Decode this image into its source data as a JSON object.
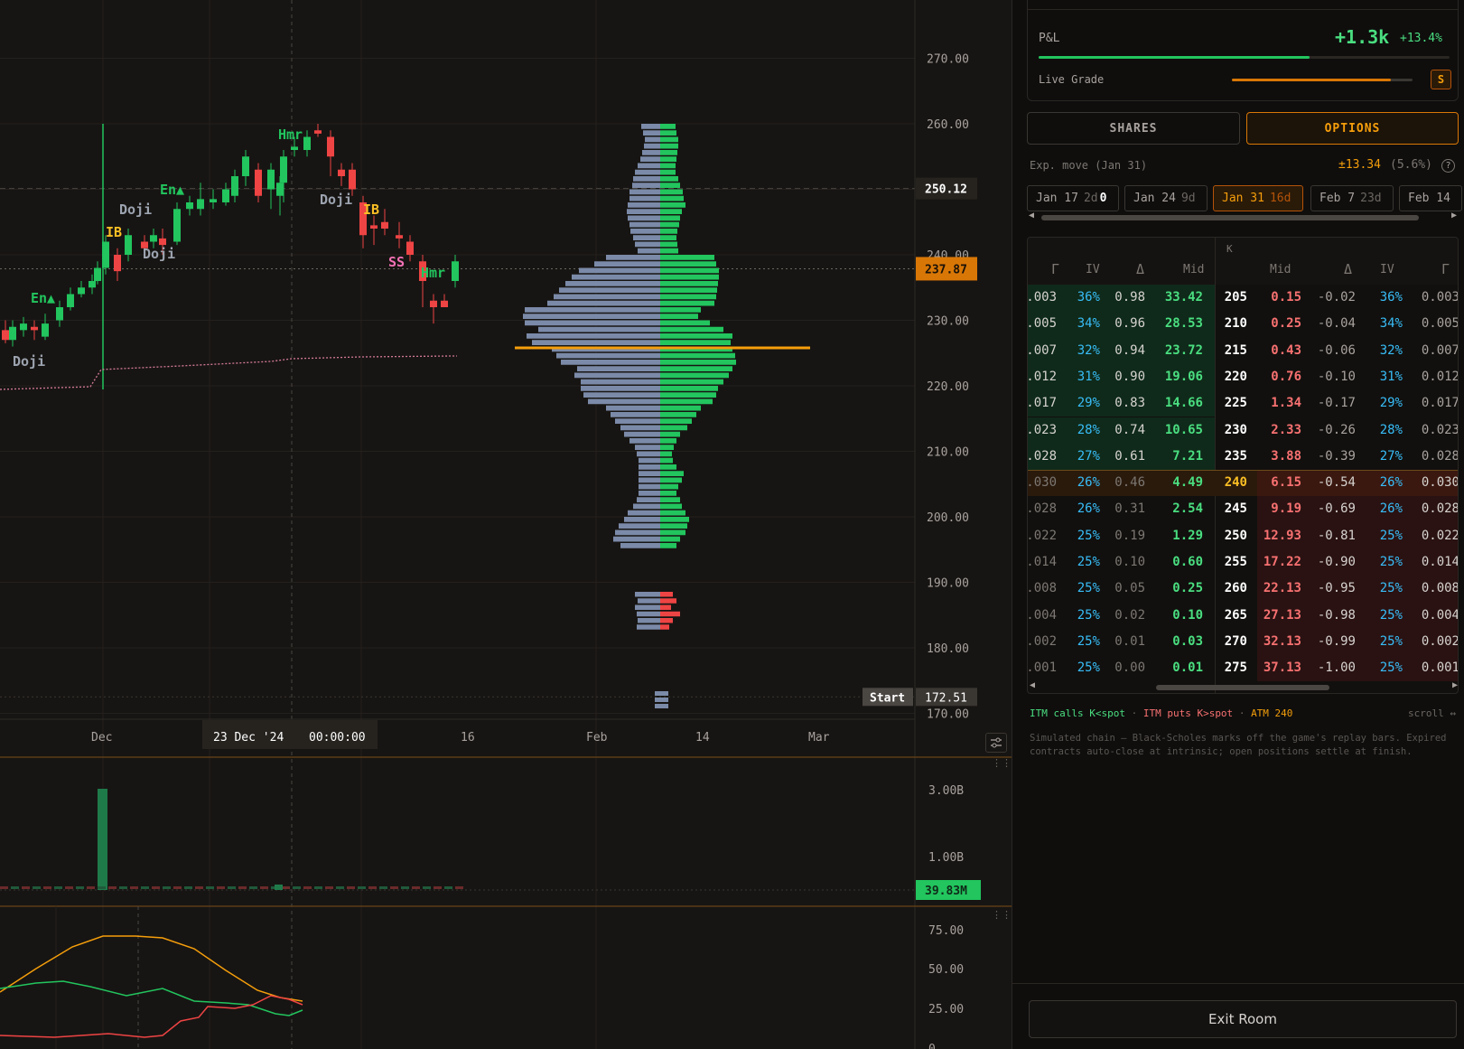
{
  "chart": {
    "price_ticks": [
      "270.00",
      "260.00",
      "250.00",
      "240.00",
      "230.00",
      "220.00",
      "210.00",
      "200.00",
      "190.00",
      "180.00",
      "170.00"
    ],
    "cursor_price": "250.12",
    "last_price": "237.87",
    "start_label": "Start",
    "start_price": "172.51",
    "time_labels": [
      "Dec",
      "16",
      "Feb",
      "14",
      "Mar"
    ],
    "crosshair_date": "23 Dec '24",
    "crosshair_time": "00:00:00",
    "patterns": [
      "Doji",
      "En▲",
      "IB",
      "Doji",
      "Doji",
      "En▲",
      "Hmr",
      "Doji",
      "IB",
      "SS",
      "Hmr"
    ],
    "volume_ticks": [
      "3.00B",
      "1.00B"
    ],
    "volume_last": "39.83M",
    "osc_ticks": [
      "75.00",
      "50.00",
      "25.00",
      "0"
    ]
  },
  "panel": {
    "pnl_label": "P&L",
    "pnl_value": "+1.3k",
    "pnl_pct": "+13.4%",
    "live_grade_label": "Live Grade",
    "live_grade_value": "S",
    "tab_shares": "SHARES",
    "tab_options": "OPTIONS",
    "exp_move_label": "Exp. move (Jan 31)",
    "exp_move_value": "±13.34",
    "exp_move_pct": "(5.6%)",
    "help_icon": "?",
    "expiries": [
      {
        "date": "Jan 17",
        "days": "2d",
        "extra": "0"
      },
      {
        "date": "Jan 24",
        "days": "9d",
        "extra": ""
      },
      {
        "date": "Jan 31",
        "days": "16d",
        "extra": ""
      },
      {
        "date": "Feb 7",
        "days": "23d",
        "extra": ""
      },
      {
        "date": "Feb 14",
        "days": "",
        "extra": ""
      }
    ],
    "chain_headers": {
      "strike": "K",
      "call_gamma": "Γ",
      "call_iv": "IV",
      "call_delta": "Δ",
      "call_mid": "Mid",
      "put_mid": "Mid",
      "put_delta": "Δ",
      "put_iv": "IV",
      "put_gamma": "Γ"
    },
    "chain_rows": [
      {
        "cg": ".003",
        "civ": "36%",
        "cd": "0.98",
        "cm": "33.42",
        "k": "205",
        "pm": "0.15",
        "pd": "-0.02",
        "piv": "36%",
        "pg": "0.003"
      },
      {
        "cg": ".005",
        "civ": "34%",
        "cd": "0.96",
        "cm": "28.53",
        "k": "210",
        "pm": "0.25",
        "pd": "-0.04",
        "piv": "34%",
        "pg": "0.005"
      },
      {
        "cg": ".007",
        "civ": "32%",
        "cd": "0.94",
        "cm": "23.72",
        "k": "215",
        "pm": "0.43",
        "pd": "-0.06",
        "piv": "32%",
        "pg": "0.007"
      },
      {
        "cg": ".012",
        "civ": "31%",
        "cd": "0.90",
        "cm": "19.06",
        "k": "220",
        "pm": "0.76",
        "pd": "-0.10",
        "piv": "31%",
        "pg": "0.012"
      },
      {
        "cg": ".017",
        "civ": "29%",
        "cd": "0.83",
        "cm": "14.66",
        "k": "225",
        "pm": "1.34",
        "pd": "-0.17",
        "piv": "29%",
        "pg": "0.017"
      },
      {
        "cg": ".023",
        "civ": "28%",
        "cd": "0.74",
        "cm": "10.65",
        "k": "230",
        "pm": "2.33",
        "pd": "-0.26",
        "piv": "28%",
        "pg": "0.023"
      },
      {
        "cg": ".028",
        "civ": "27%",
        "cd": "0.61",
        "cm": "7.21",
        "k": "235",
        "pm": "3.88",
        "pd": "-0.39",
        "piv": "27%",
        "pg": "0.028"
      },
      {
        "cg": ".030",
        "civ": "26%",
        "cd": "0.46",
        "cm": "4.49",
        "k": "240",
        "pm": "6.15",
        "pd": "-0.54",
        "piv": "26%",
        "pg": "0.030"
      },
      {
        "cg": ".028",
        "civ": "26%",
        "cd": "0.31",
        "cm": "2.54",
        "k": "245",
        "pm": "9.19",
        "pd": "-0.69",
        "piv": "26%",
        "pg": "0.028"
      },
      {
        "cg": ".022",
        "civ": "25%",
        "cd": "0.19",
        "cm": "1.29",
        "k": "250",
        "pm": "12.93",
        "pd": "-0.81",
        "piv": "25%",
        "pg": "0.022"
      },
      {
        "cg": ".014",
        "civ": "25%",
        "cd": "0.10",
        "cm": "0.60",
        "k": "255",
        "pm": "17.22",
        "pd": "-0.90",
        "piv": "25%",
        "pg": "0.014"
      },
      {
        "cg": ".008",
        "civ": "25%",
        "cd": "0.05",
        "cm": "0.25",
        "k": "260",
        "pm": "22.13",
        "pd": "-0.95",
        "piv": "25%",
        "pg": "0.008"
      },
      {
        "cg": ".004",
        "civ": "25%",
        "cd": "0.02",
        "cm": "0.10",
        "k": "265",
        "pm": "27.13",
        "pd": "-0.98",
        "piv": "25%",
        "pg": "0.004"
      },
      {
        "cg": ".002",
        "civ": "25%",
        "cd": "0.01",
        "cm": "0.03",
        "k": "270",
        "pm": "32.13",
        "pd": "-0.99",
        "piv": "25%",
        "pg": "0.002"
      },
      {
        "cg": ".001",
        "civ": "25%",
        "cd": "0.00",
        "cm": "0.01",
        "k": "275",
        "pm": "37.13",
        "pd": "-1.00",
        "piv": "25%",
        "pg": "0.001"
      }
    ],
    "atm_strike": "240",
    "legend_itm_calls": "ITM calls K<spot",
    "legend_itm_puts": "ITM puts K>spot",
    "legend_atm": "ATM 240",
    "legend_dot": "·",
    "scroll_hint": "scroll ↔",
    "note": "Simulated chain — Black-Scholes marks off the game's replay bars. Expired contracts auto-close at intrinsic; open positions settle at finish.",
    "exit_label": "Exit Room"
  },
  "colors": {
    "green": "#22c55e",
    "red": "#ef4444",
    "orange": "#f59e0b",
    "blue": "#38bdf8",
    "profile_gray": "#7b8aa8"
  }
}
